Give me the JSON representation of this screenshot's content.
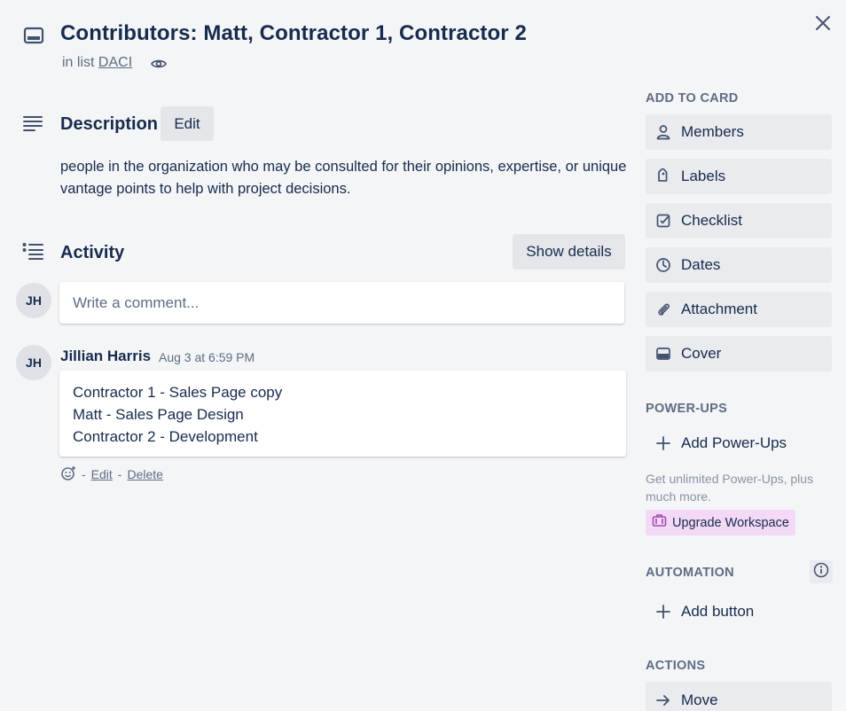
{
  "card": {
    "title": "Contributors: Matt, Contractor 1, Contractor 2",
    "in_list_prefix": "in list",
    "list_name": "DACI"
  },
  "description": {
    "heading": "Description",
    "edit_label": "Edit",
    "text": "people in the organization who may be consulted for their opinions, expertise, or unique vantage points to help with project decisions."
  },
  "activity": {
    "heading": "Activity",
    "show_details_label": "Show details",
    "comment_placeholder": "Write a comment...",
    "current_user_initials": "JH",
    "comments": [
      {
        "author_initials": "JH",
        "author": "Jillian Harris",
        "time": "Aug 3 at 6:59 PM",
        "lines": [
          "Contractor 1 - Sales Page copy",
          "Matt - Sales Page Design",
          "Contractor 2 - Development"
        ],
        "separator": "-",
        "edit_label": "Edit",
        "dash": "-",
        "delete_label": "Delete"
      }
    ]
  },
  "sidebar": {
    "add_to_card": {
      "heading": "ADD TO CARD",
      "items": [
        {
          "label": "Members",
          "icon": "person-icon"
        },
        {
          "label": "Labels",
          "icon": "tag-icon"
        },
        {
          "label": "Checklist",
          "icon": "checkbox-icon"
        },
        {
          "label": "Dates",
          "icon": "clock-icon"
        },
        {
          "label": "Attachment",
          "icon": "paperclip-icon"
        },
        {
          "label": "Cover",
          "icon": "cover-icon"
        }
      ]
    },
    "power_ups": {
      "heading": "POWER-UPS",
      "add_label": "Add Power-Ups",
      "note": "Get unlimited Power-Ups, plus much more.",
      "upgrade_label": "Upgrade Workspace"
    },
    "automation": {
      "heading": "AUTOMATION",
      "add_button_label": "Add button"
    },
    "actions": {
      "heading": "ACTIONS",
      "items": [
        {
          "label": "Move",
          "icon": "arrow-right-icon"
        }
      ]
    }
  },
  "colors": {
    "background": "#f4f5f7",
    "text": "#172b4d",
    "subtle_text": "#5e6c84",
    "button_bg": "#e9ebee",
    "upgrade_bg": "#f3d9f6",
    "upgrade_icon": "#9f4ab1"
  }
}
